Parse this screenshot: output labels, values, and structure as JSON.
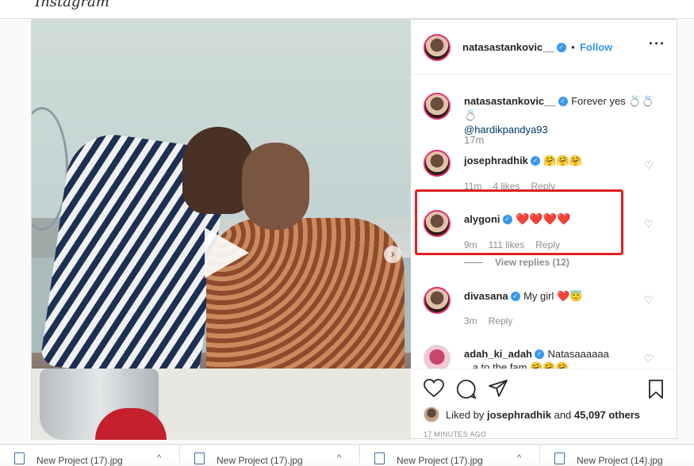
{
  "post_header": {
    "username": "natasastankovic__",
    "separator": "•",
    "follow_label": "Follow",
    "more_icon": "ellipsis-icon"
  },
  "caption": {
    "username": "natasastankovic__",
    "text": "Forever yes 💍💍💍",
    "mention": "@hardikpandya93",
    "time": "17m"
  },
  "comments": [
    {
      "username": "josephradhik",
      "verified": true,
      "text": "🤗🤗🤗",
      "time": "11m",
      "likes": "4 likes",
      "reply": "Reply"
    },
    {
      "username": "alygoni",
      "verified": true,
      "text": "❤️❤️❤️❤️",
      "time": "9m",
      "likes": "111 likes",
      "reply": "Reply",
      "view_replies": "View replies (12)"
    },
    {
      "username": "divasana",
      "verified": true,
      "text": "My girl ❤️😇",
      "time": "3m",
      "reply": "Reply"
    },
    {
      "username": "adah_ki_adah",
      "verified": true,
      "text": "Natasaaaaaa",
      "subtext": "...a to the fam 🤗🤗🤗"
    }
  ],
  "likes_line": {
    "prefix": "Liked by",
    "liker": "josephradhik",
    "and": "and",
    "count": "45,097 others"
  },
  "timestamp": "17 MINUTES AGO",
  "taskbar": [
    {
      "label": "New Project (17).jpg"
    },
    {
      "label": "New Project (17).jpg"
    },
    {
      "label": "New Project (17).jpg"
    },
    {
      "label": "New Project (14).jpg"
    }
  ],
  "colors": {
    "link": "#3897f0",
    "highlight": "#e02020",
    "text": "#262626",
    "muted": "#8e8e8e"
  }
}
